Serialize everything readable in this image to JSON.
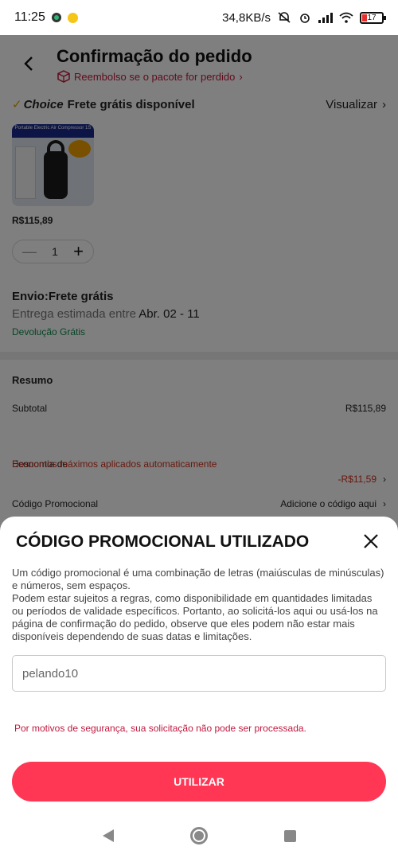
{
  "status_bar": {
    "time": "11:25",
    "network_speed": "34,8KB/s",
    "battery": "17"
  },
  "header": {
    "title": "Confirmação do pedido",
    "refund_note": "Reembolso se o pacote for perdido"
  },
  "choice": {
    "brand": "Choice",
    "label": "Frete grátis disponível",
    "view_link": "Visualizar"
  },
  "product": {
    "image_banner": "Portable Electric Air Compressor 1S",
    "price": "R$115,89",
    "quantity": "1"
  },
  "shipping": {
    "title": "Envio:Frete grátis",
    "estimate_prefix": "Entrega estimada entre ",
    "estimate_dates": "Abr. 02 - 11",
    "returns": "Devolução Grátis"
  },
  "summary": {
    "title": "Resumo",
    "subtotal_label": "Subtotal",
    "subtotal_value": "R$115,89",
    "savings_label": "Economia de",
    "savings_sub": "Descontos máximos aplicados automaticamente",
    "savings_value": "-R$11,59",
    "promo_label": "Código Promocional",
    "promo_action": "Adicione o código aqui"
  },
  "sheet": {
    "title": "CÓDIGO PROMOCIONAL UTILIZADO",
    "desc1": "Um código promocional é uma combinação de letras (maiúsculas de minúsculas) e números, sem espaços.",
    "desc2": "Podem estar sujeitos a regras, como disponibilidade em quantidades limitadas ou períodos de validade específicos. Portanto, ao solicitá-los aqui ou usá-los na página de confirmação do pedido, observe que eles podem não estar mais disponíveis dependendo de suas datas e limitações.",
    "input_value": "pelando10",
    "error": "Por motivos de segurança, sua solicitação não pode ser processada.",
    "button": "UTILIZAR"
  },
  "colors": {
    "accent": "#ff3654",
    "error": "#c0183d",
    "discount": "#d0311c",
    "green": "#118a4e"
  }
}
